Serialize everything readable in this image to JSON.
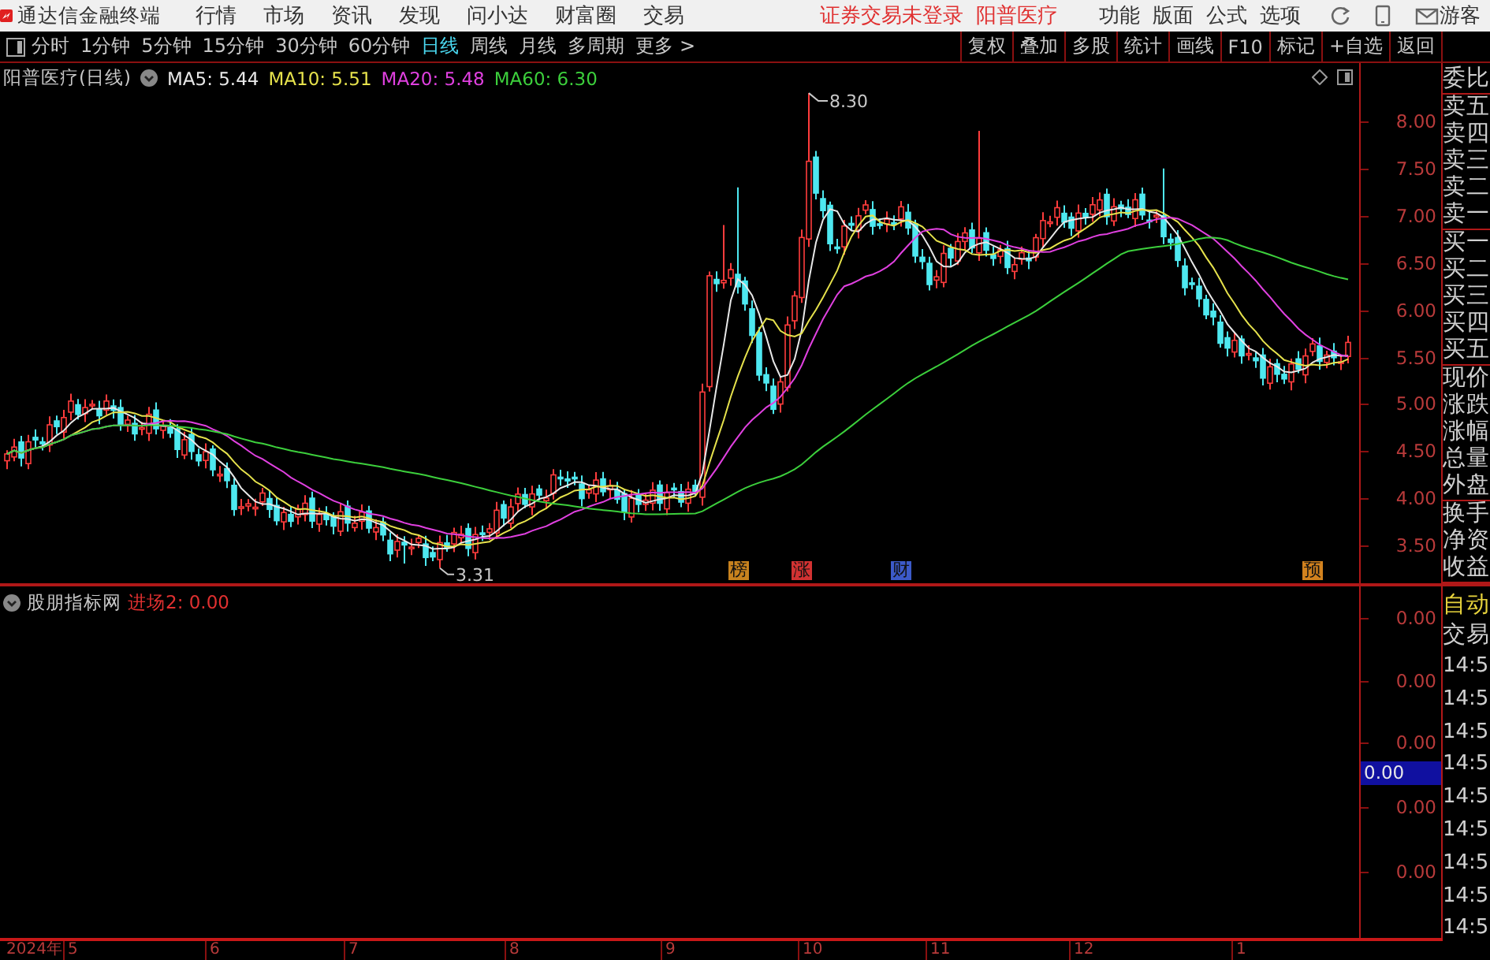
{
  "menu_bar": {
    "app_title": "通达信金融终端",
    "items": [
      "行情",
      "市场",
      "资讯",
      "发现",
      "问小达",
      "财富圈",
      "交易"
    ],
    "login_status": "证券交易未登录",
    "stock_name": "阳普医疗",
    "function_items": [
      "功能",
      "版面",
      "公式",
      "选项"
    ],
    "user": "游客"
  },
  "toolbar": {
    "periods": [
      {
        "label": "分时",
        "selected": false
      },
      {
        "label": "1分钟",
        "selected": false
      },
      {
        "label": "5分钟",
        "selected": false
      },
      {
        "label": "15分钟",
        "selected": false
      },
      {
        "label": "30分钟",
        "selected": false
      },
      {
        "label": "60分钟",
        "selected": false
      },
      {
        "label": "日线",
        "selected": true
      },
      {
        "label": "周线",
        "selected": false
      },
      {
        "label": "月线",
        "selected": false
      },
      {
        "label": "多周期",
        "selected": false
      },
      {
        "label": "更多 >",
        "selected": false
      }
    ],
    "buttons": [
      "复权",
      "叠加",
      "多股",
      "统计",
      "画线",
      "F10",
      "标记",
      "+自选",
      "返回"
    ]
  },
  "price_chart": {
    "title": "阳普医疗(日线)",
    "moving_averages": [
      {
        "label": "MA5: 5.44",
        "color": "#e8e8e8"
      },
      {
        "label": "MA10: 5.51",
        "color": "#e6e24c"
      },
      {
        "label": "MA20: 5.48",
        "color": "#e040e0"
      },
      {
        "label": "MA60: 6.30",
        "color": "#3ccf3c"
      }
    ],
    "high_label": "8.30",
    "low_label": "3.31",
    "y_ticks": [
      "8.00",
      "7.50",
      "7.00",
      "6.50",
      "6.00",
      "5.50",
      "5.00",
      "4.50",
      "4.00",
      "3.50"
    ],
    "markers": [
      {
        "label": "榜",
        "color": "#c8821e"
      },
      {
        "label": "涨",
        "color": "#d23232"
      },
      {
        "label": "财",
        "color": "#3c5ac8"
      },
      {
        "label": "预",
        "color": "#d2821e"
      }
    ]
  },
  "indicator": {
    "name": "股朋指标网",
    "reading": "进场2: 0.00",
    "y_ticks": [
      "0.00",
      "0.00",
      "0.00",
      "0.00",
      "0.00"
    ],
    "crosshair_value": "0.00"
  },
  "date_axis": [
    "2024年",
    "5",
    "6",
    "7",
    "8",
    "9",
    "10",
    "11",
    "12",
    "1"
  ],
  "quote_panel": {
    "groups": [
      [
        "委比"
      ],
      [
        "卖五",
        "卖四",
        "卖三",
        "卖二",
        "卖一"
      ],
      [
        "买一",
        "买二",
        "买三",
        "买四",
        "买五"
      ],
      [
        "现价",
        "涨跌",
        "涨幅",
        "总量",
        "外盘"
      ],
      [
        "换手",
        "净资",
        "收益"
      ]
    ],
    "auto_label": "自动",
    "trade_label": "交易",
    "times": [
      "14:5",
      "14:5",
      "14:5",
      "14:5",
      "14:5",
      "14:5",
      "14:5",
      "14:5",
      "14:5"
    ]
  }
}
